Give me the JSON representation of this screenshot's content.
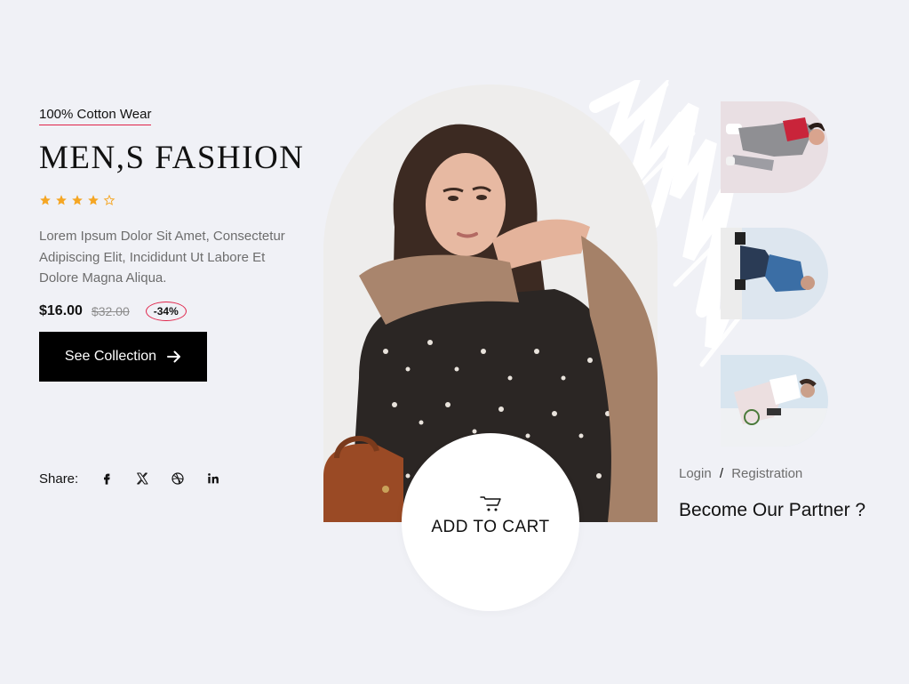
{
  "hero": {
    "eyebrow": "100% Cotton Wear",
    "title": "MEN,S FASHION",
    "rating": {
      "filled": 4,
      "total": 5
    },
    "description": "Lorem Ipsum Dolor Sit Amet, Consectetur Adipiscing Elit, Incididunt Ut Labore Et Dolore Magna Aliqua.",
    "price": "$16.00",
    "old_price": "$32.00",
    "discount": "-34%",
    "cta_label": "See Collection",
    "cta_icon": "arrow-right-icon"
  },
  "share": {
    "label": "Share:",
    "icons": [
      "facebook-icon",
      "x-icon",
      "dribbble-icon",
      "linkedin-icon"
    ]
  },
  "cart": {
    "label": "ADD TO CART",
    "icon": "cart-icon"
  },
  "sidebar": {
    "login": "Login",
    "separator": "/",
    "registration": "Registration",
    "partner": "Become Our Partner ?"
  },
  "colors": {
    "background": "#f0f1f6",
    "accent": "#e0244a",
    "star": "#f5a623",
    "button": "#000000"
  }
}
